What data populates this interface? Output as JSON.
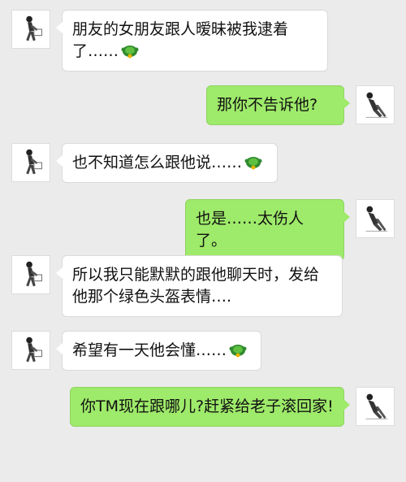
{
  "colors": {
    "background": "#ebebeb",
    "incoming_bubble": "#ffffff",
    "outgoing_bubble": "#9eea6a"
  },
  "messages": [
    {
      "side": "left",
      "text": "朋友的女朋友跟人暧昧被我逮着了……",
      "emoji": "turtle-icon"
    },
    {
      "side": "right",
      "text": "那你不告诉他?"
    },
    {
      "side": "left",
      "text": "也不知道怎么跟他说……",
      "emoji": "turtle-icon"
    },
    {
      "side": "right",
      "text": "也是……太伤人了。"
    },
    {
      "side": "left",
      "text": "所以我只能默默的跟他聊天时，发给他那个绿色头盔表情…."
    },
    {
      "side": "left",
      "text": "希望有一天他会懂……",
      "emoji": "turtle-icon"
    },
    {
      "side": "right",
      "text": "你TM现在跟哪儿?赶紧给老子滚回家!"
    }
  ]
}
